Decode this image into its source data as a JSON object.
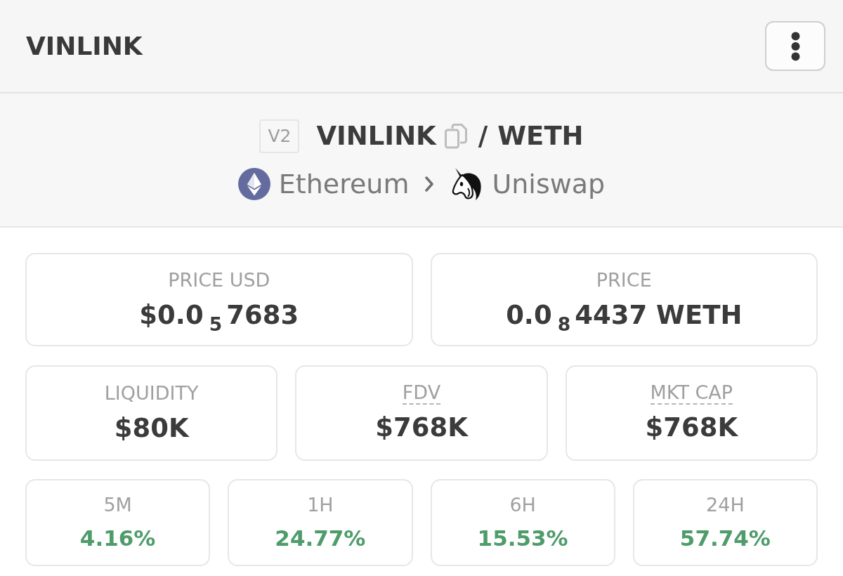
{
  "header": {
    "title": "VINLINK"
  },
  "pair": {
    "version": "V2",
    "base_token": "VINLINK",
    "separator": "/",
    "quote_token": "WETH",
    "chain": "Ethereum",
    "dex": "Uniswap"
  },
  "price_cards": [
    {
      "label": "PRICE USD",
      "value": "$0.0$_{5}$7683"
    },
    {
      "label": "PRICE",
      "value": "0.0$_{8}$4437 WETH"
    }
  ],
  "stats": [
    {
      "label": "LIQUIDITY",
      "value": "$80K",
      "tooltip": false
    },
    {
      "label": "FDV",
      "value": "$768K",
      "tooltip": true
    },
    {
      "label": "MKT CAP",
      "value": "$768K",
      "tooltip": true
    }
  ],
  "changes": [
    {
      "period": "5M",
      "value": "4.16%",
      "positive": true
    },
    {
      "period": "1H",
      "value": "24.77%",
      "positive": true
    },
    {
      "period": "6H",
      "value": "15.53%",
      "positive": true
    },
    {
      "period": "24H",
      "value": "57.74%",
      "positive": true
    }
  ]
}
